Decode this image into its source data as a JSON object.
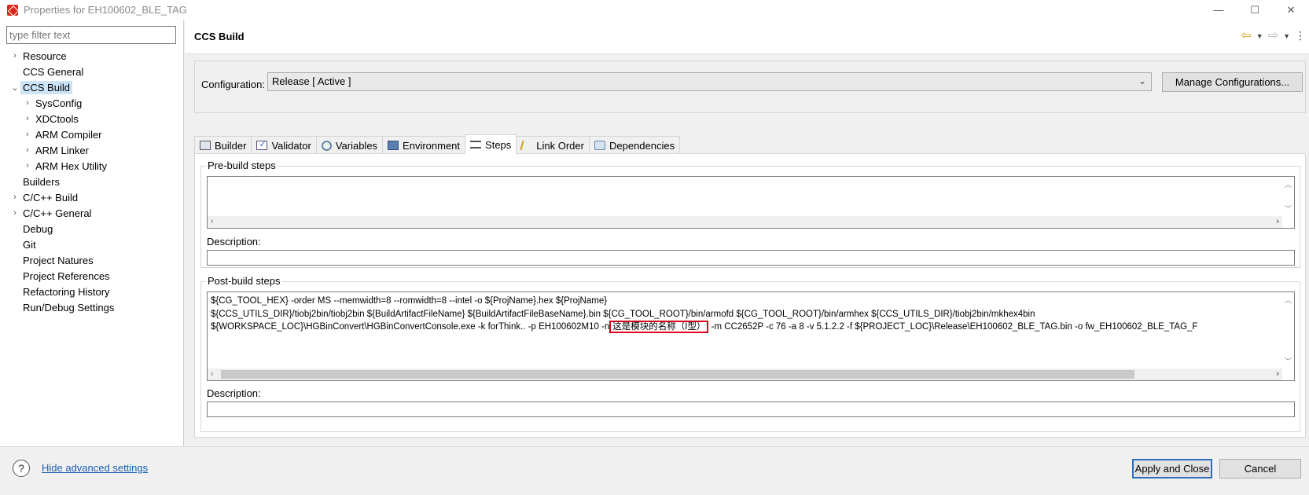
{
  "window": {
    "title": "Properties for EH100602_BLE_TAG",
    "controls": [
      "—",
      "☐",
      "✕"
    ]
  },
  "sidebar": {
    "filter_placeholder": "type filter text",
    "items": [
      {
        "label": "Resource",
        "arrow": "›",
        "level": 0
      },
      {
        "label": "CCS General",
        "arrow": "",
        "level": 0
      },
      {
        "label": "CCS Build",
        "arrow": "⌄",
        "level": 0,
        "selected": true
      },
      {
        "label": "SysConfig",
        "arrow": "›",
        "level": 1
      },
      {
        "label": "XDCtools",
        "arrow": "›",
        "level": 1
      },
      {
        "label": "ARM Compiler",
        "arrow": "›",
        "level": 1
      },
      {
        "label": "ARM Linker",
        "arrow": "›",
        "level": 1
      },
      {
        "label": "ARM Hex Utility",
        "arrow": "›",
        "level": 1
      },
      {
        "label": "Builders",
        "arrow": "",
        "level": 0
      },
      {
        "label": "C/C++ Build",
        "arrow": "›",
        "level": 0
      },
      {
        "label": "C/C++ General",
        "arrow": "›",
        "level": 0
      },
      {
        "label": "Debug",
        "arrow": "",
        "level": 0
      },
      {
        "label": "Git",
        "arrow": "",
        "level": 0
      },
      {
        "label": "Project Natures",
        "arrow": "",
        "level": 0
      },
      {
        "label": "Project References",
        "arrow": "",
        "level": 0
      },
      {
        "label": "Refactoring History",
        "arrow": "",
        "level": 0
      },
      {
        "label": "Run/Debug Settings",
        "arrow": "",
        "level": 0
      }
    ]
  },
  "main": {
    "title": "CCS Build",
    "configuration_label": "Configuration:",
    "configuration_value": "Release  [ Active ]",
    "manage_button": "Manage Configurations...",
    "tabs": [
      {
        "label": "Builder",
        "icon": "builder-icon"
      },
      {
        "label": "Validator",
        "icon": "validator-icon"
      },
      {
        "label": "Variables",
        "icon": "variables-icon"
      },
      {
        "label": "Environment",
        "icon": "environment-icon"
      },
      {
        "label": "Steps",
        "icon": "steps-icon",
        "active": true
      },
      {
        "label": "Link Order",
        "icon": "link-order-icon"
      },
      {
        "label": "Dependencies",
        "icon": "dependencies-icon"
      }
    ],
    "pre_build": {
      "title": "Pre-build steps",
      "commands": "",
      "description_label": "Description:",
      "description_value": ""
    },
    "post_build": {
      "title": "Post-build steps",
      "lines": [
        "${CG_TOOL_HEX} -order MS --memwidth=8 --romwidth=8 --intel -o ${ProjName}.hex ${ProjName}",
        "${CCS_UTILS_DIR}/tiobj2bin/tiobj2bin ${BuildArtifactFileName} ${BuildArtifactFileBaseName}.bin ${CG_TOOL_ROOT}/bin/armofd ${CG_TOOL_ROOT}/bin/armhex ${CCS_UTILS_DIR}/tiobj2bin/mkhex4bin"
      ],
      "line3_before": "${WORKSPACE_LOC}\\HGBinConvert\\HGBinConvertConsole.exe -k forThink.. -p EH100602M10 -n",
      "line3_highlight": "这是模块的名称（I型）",
      "line3_after": " -m CC2652P -c 76 -a 8 -v 5.1.2.2 -f  ${PROJECT_LOC}\\Release\\EH100602_BLE_TAG.bin -o fw_EH100602_BLE_TAG_F",
      "description_label": "Description:",
      "description_value": ""
    }
  },
  "footer": {
    "help": "?",
    "hide_advanced": "Hide advanced settings",
    "apply_close": "Apply and Close",
    "cancel": "Cancel"
  },
  "colors": {
    "selection": "#cce4f7",
    "link": "#1a5fb4",
    "highlight_border": "#e0001a",
    "default_button_border": "#2e6fc1"
  }
}
